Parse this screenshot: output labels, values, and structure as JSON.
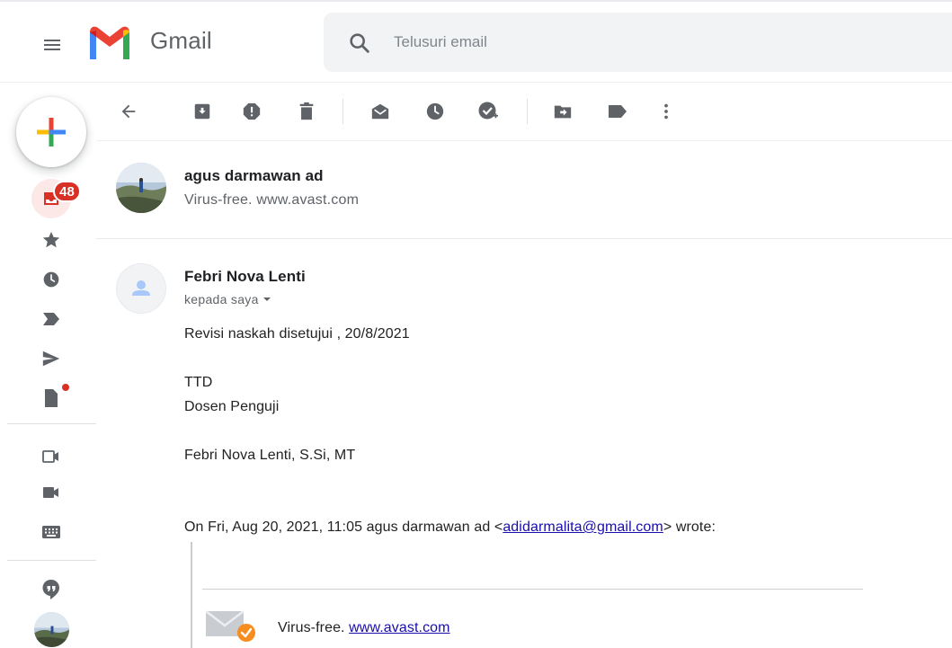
{
  "app": {
    "name": "Gmail"
  },
  "search": {
    "placeholder": "Telusuri email"
  },
  "nav": {
    "inbox_badge": "48"
  },
  "toolbar": {
    "buttons": [
      "back",
      "archive",
      "report-spam",
      "delete",
      "mark-unread",
      "snooze",
      "add-to-tasks",
      "move-to",
      "labels",
      "more"
    ]
  },
  "messages": [
    {
      "sender": "agus darmawan ad",
      "snippet": "Virus-free. www.avast.com"
    },
    {
      "sender": "Febri Nova Lenti",
      "to": "kepada saya",
      "body": {
        "line1": "Revisi naskah  disetujui , 20/8/2021",
        "line2": "TTD",
        "line3": "Dosen Penguji",
        "line4": "Febri Nova Lenti, S.Si, MT"
      },
      "quote": {
        "prefix": "On Fri, Aug 20, 2021, 11:05 agus darmawan ad <",
        "email": "adidarmalita@gmail.com",
        "suffix": "> wrote:"
      },
      "signature": {
        "text": "Virus-free. ",
        "link": "www.avast.com"
      }
    }
  ],
  "colors": {
    "badge": "#d93025",
    "link": "#1a0dab",
    "search_bg": "#f1f3f4",
    "icon": "#5f6368"
  }
}
